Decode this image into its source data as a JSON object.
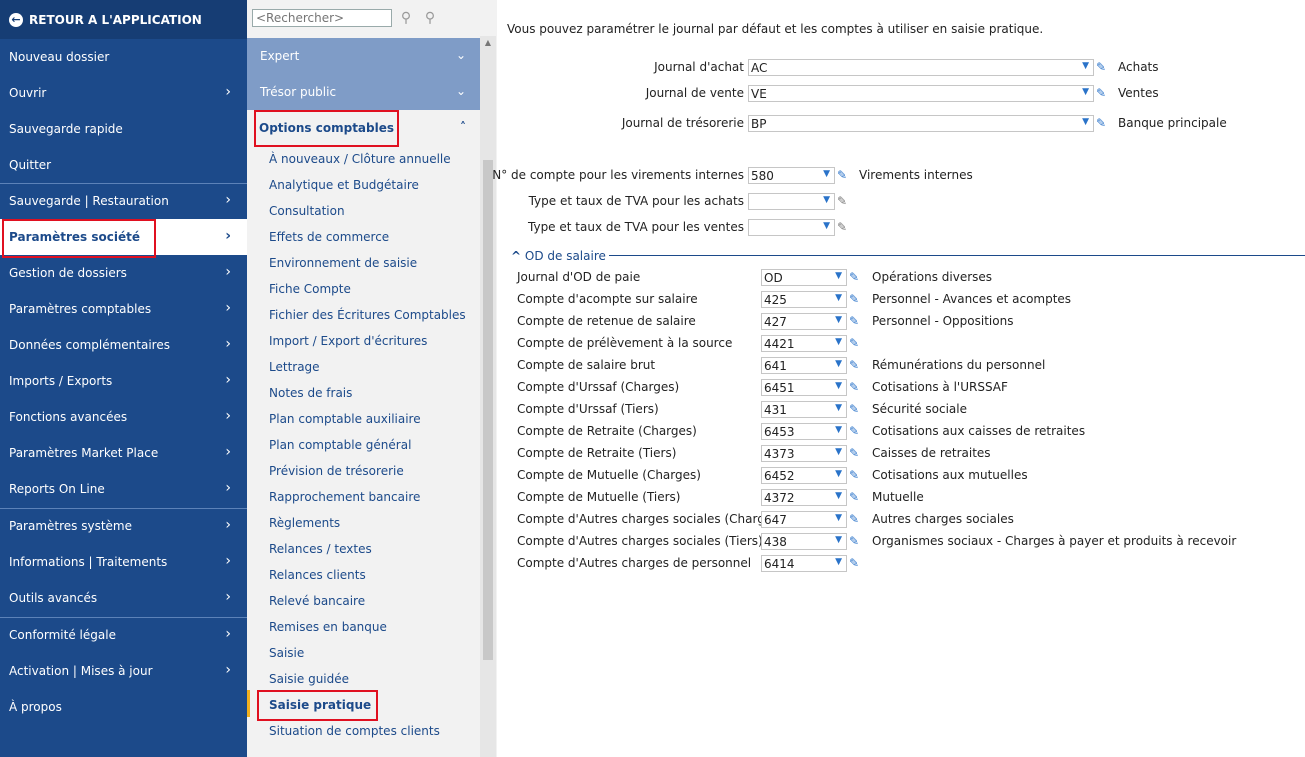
{
  "leftnav": {
    "back_label": "RETOUR A L'APPLICATION",
    "items": [
      {
        "label": "Nouveau dossier",
        "chev": ""
      },
      {
        "label": "Ouvrir",
        "chev": "›"
      },
      {
        "label": "Sauvegarde rapide",
        "chev": ""
      },
      {
        "label": "Quitter",
        "chev": ""
      },
      {
        "label": "Sauvegarde | Restauration",
        "chev": "›"
      },
      {
        "label": "Paramètres société",
        "chev": "›"
      },
      {
        "label": "Gestion de dossiers",
        "chev": "›"
      },
      {
        "label": "Paramètres comptables",
        "chev": "›"
      },
      {
        "label": "Données complémentaires",
        "chev": "›"
      },
      {
        "label": "Imports / Exports",
        "chev": "›"
      },
      {
        "label": "Fonctions avancées",
        "chev": "›"
      },
      {
        "label": "Paramètres Market Place",
        "chev": "›"
      },
      {
        "label": "Reports On Line",
        "chev": "›"
      },
      {
        "label": "Paramètres système",
        "chev": "›"
      },
      {
        "label": "Informations | Traitements",
        "chev": "›"
      },
      {
        "label": "Outils avancés",
        "chev": "›"
      },
      {
        "label": "Conformité légale",
        "chev": "›"
      },
      {
        "label": "Activation | Mises à jour",
        "chev": "›"
      },
      {
        "label": "À propos",
        "chev": ""
      }
    ]
  },
  "midpanel": {
    "search_placeholder": "<Rechercher>",
    "search_icon": "search-icon",
    "heads": [
      {
        "label": "Expert"
      },
      {
        "label": "Trésor public"
      }
    ],
    "open_head": "Options comptables",
    "sub_items": [
      "À nouveaux / Clôture annuelle",
      "Analytique et Budgétaire",
      "Consultation",
      "Effets de commerce",
      "Environnement de saisie",
      "Fiche Compte",
      "Fichier des Écritures Comptables",
      "Import / Export d'écritures",
      "Lettrage",
      "Notes de frais",
      "Plan comptable auxiliaire",
      "Plan comptable général",
      "Prévision de trésorerie",
      "Rapprochement bancaire",
      "Règlements",
      "Relances / textes",
      "Relances clients",
      "Relevé bancaire",
      "Remises en banque",
      "Saisie",
      "Saisie guidée",
      "Saisie pratique",
      "Situation de comptes clients"
    ]
  },
  "content": {
    "intro": "Vous pouvez paramétrer le journal par défaut et les comptes à utiliser en saisie pratique.",
    "journaux": [
      {
        "label": "Journal d'achat",
        "value": "AC",
        "desc": "Achats"
      },
      {
        "label": "Journal de vente",
        "value": "VE",
        "desc": "Ventes"
      },
      {
        "label": "Journal de trésorerie",
        "value": "BP",
        "desc": "Banque principale"
      }
    ],
    "comptes": [
      {
        "label": "N° de compte pour les virements internes",
        "value": "580",
        "desc": "Virements internes"
      },
      {
        "label": "Type et taux de TVA pour les achats",
        "value": "",
        "desc": ""
      },
      {
        "label": "Type et taux de TVA pour les ventes",
        "value": "",
        "desc": ""
      }
    ],
    "section_title": "OD de salaire",
    "section_toggle": "^",
    "od_rows": [
      {
        "label": "Journal d'OD de paie",
        "value": "OD",
        "desc": "Opérations diverses"
      },
      {
        "label": "Compte d'acompte sur salaire",
        "value": "425",
        "desc": "Personnel - Avances et acomptes"
      },
      {
        "label": "Compte de retenue de salaire",
        "value": "427",
        "desc": "Personnel - Oppositions"
      },
      {
        "label": "Compte de prélèvement à la source",
        "value": "4421",
        "desc": ""
      },
      {
        "label": "Compte de salaire brut",
        "value": "641",
        "desc": "Rémunérations du personnel"
      },
      {
        "label": "Compte d'Urssaf (Charges)",
        "value": "6451",
        "desc": "Cotisations à l'URSSAF"
      },
      {
        "label": "Compte d'Urssaf (Tiers)",
        "value": "431",
        "desc": "Sécurité sociale"
      },
      {
        "label": "Compte de Retraite (Charges)",
        "value": "6453",
        "desc": "Cotisations aux caisses de retraites"
      },
      {
        "label": "Compte de Retraite (Tiers)",
        "value": "4373",
        "desc": "Caisses de retraites"
      },
      {
        "label": "Compte de Mutuelle (Charges)",
        "value": "6452",
        "desc": "Cotisations aux mutuelles"
      },
      {
        "label": "Compte de Mutuelle (Tiers)",
        "value": "4372",
        "desc": "Mutuelle"
      },
      {
        "label": "Compte d'Autres charges sociales (Charges)",
        "value": "647",
        "desc": "Autres charges sociales"
      },
      {
        "label": "Compte d'Autres charges sociales (Tiers)",
        "value": "438",
        "desc": "Organismes sociaux - Charges à payer et produits à recevoir"
      },
      {
        "label": "Compte d'Autres charges de personnel",
        "value": "6414",
        "desc": ""
      }
    ]
  },
  "colors": {
    "nav_bg": "#1c4a8a",
    "accent": "#2a73c9",
    "highlight": "#e01020"
  }
}
